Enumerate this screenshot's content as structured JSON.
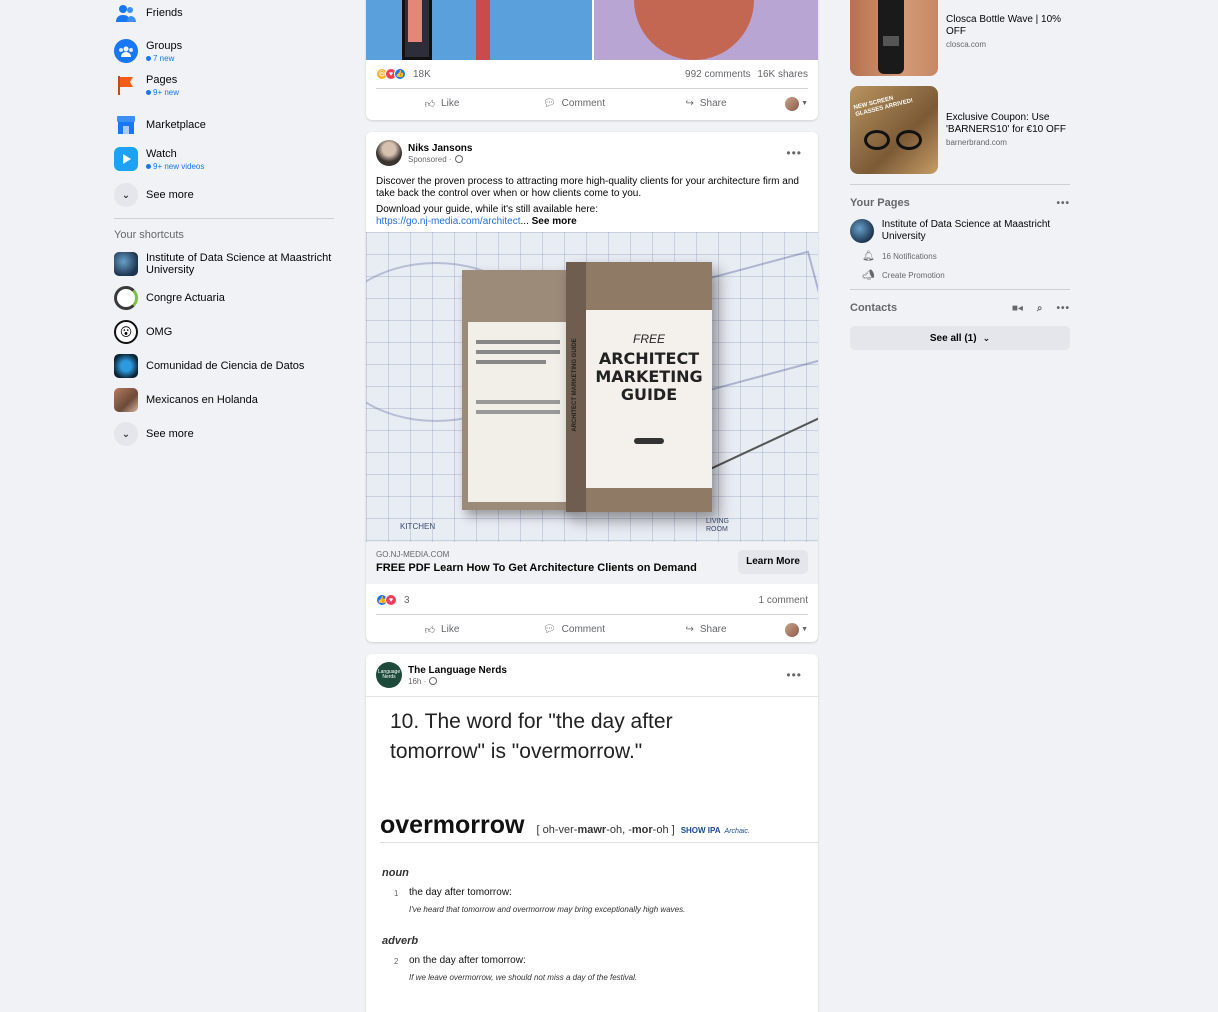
{
  "sidebar": {
    "items": [
      {
        "label": "Friends",
        "sub": ""
      },
      {
        "label": "Groups",
        "sub": "7 new"
      },
      {
        "label": "Pages",
        "sub": "9+ new"
      },
      {
        "label": "Marketplace",
        "sub": ""
      },
      {
        "label": "Watch",
        "sub": "9+ new videos"
      }
    ],
    "see_more": "See more",
    "shortcuts_title": "Your shortcuts",
    "shortcuts": [
      {
        "label": "Institute of Data Science at Maastricht University"
      },
      {
        "label": "Congre Actuaria"
      },
      {
        "label": "OMG"
      },
      {
        "label": "Comunidad de Ciencia de Datos"
      },
      {
        "label": "Mexicanos en Holanda"
      }
    ],
    "shortcuts_see_more": "See more"
  },
  "post1": {
    "reaction_count": "18K",
    "comments": "992 comments",
    "shares": "16K shares",
    "like": "Like",
    "comment": "Comment",
    "share": "Share"
  },
  "post2": {
    "author": "Niks Jansons",
    "meta": "Sponsored ·",
    "text1": "Discover the proven process to attracting more high-quality clients for your architecture firm and take back the control over when or how clients come to you.",
    "text2": "Download your guide, while it's still available here:",
    "link": "https://go.nj-media.com/architect",
    "ellipsis": "...",
    "see_more": "See more",
    "book_free": "FREE",
    "book_title": "ARCHITECT MARKETING GUIDE",
    "book_spine": "ARCHITECT MARKETING GUIDE",
    "plan_kitchen": "KITCHEN",
    "plan_living": "LIVING ROOM",
    "domain": "GO.NJ-MEDIA.COM",
    "headline": "FREE PDF Learn How To Get Architecture Clients on Demand",
    "cta": "Learn More",
    "reaction_count": "3",
    "comments": "1 comment",
    "like": "Like",
    "comment": "Comment",
    "share": "Share"
  },
  "post3": {
    "author": "The Language Nerds",
    "meta": "16h ·",
    "avatar_text": "Language Nerds",
    "fact": "10. The word for \"the day after tomorrow\" is \"overmorrow.\"",
    "word": "overmorrow",
    "pron_a": "[ oh-ver-",
    "pron_b": "mawr",
    "pron_c": "-oh, ‑",
    "pron_d": "mor",
    "pron_e": "-oh ]",
    "show_ipa": "SHOW IPA",
    "archaic": "Archaic.",
    "pos1": "noun",
    "num1": "1",
    "def1": "the day after tomorrow:",
    "ex1": "I've heard that tomorrow and overmorrow may bring exceptionally high waves.",
    "pos2": "adverb",
    "num2": "2",
    "def2": "on the day after tomorrow:",
    "ex2": "If we leave overmorrow, we should not miss a day of the festival."
  },
  "right": {
    "ads": [
      {
        "title": "Closca Bottle Wave | 10% OFF",
        "domain": "closca.com"
      },
      {
        "title": "Exclusive Coupon: Use 'BARNERS10' for €10 OFF",
        "domain": "barnerbrand.com"
      }
    ],
    "ad2_overlay": "NEW SCREEN GLASSES ARRIVED!",
    "your_pages_title": "Your Pages",
    "page_name": "Institute of Data Science at Maastricht University",
    "notifications": "16 Notifications",
    "create_promotion": "Create Promotion",
    "contacts_title": "Contacts",
    "see_all": "See all (1)"
  },
  "colors": {
    "accent": "#1877f2",
    "background": "#f0f2f5",
    "card": "#ffffff",
    "secondary_text": "#65676b"
  }
}
